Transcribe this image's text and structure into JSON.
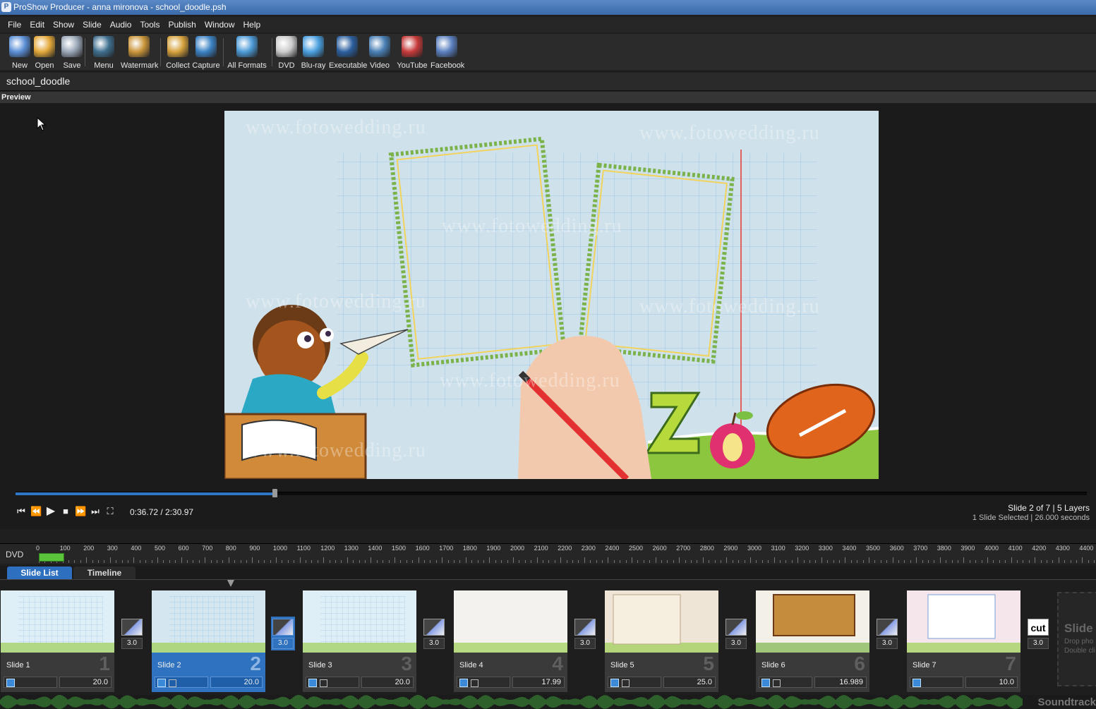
{
  "window": {
    "title": "ProShow Producer - anna mironova - school_doodle.psh"
  },
  "menu": [
    "File",
    "Edit",
    "Show",
    "Slide",
    "Audio",
    "Tools",
    "Publish",
    "Window",
    "Help"
  ],
  "toolbar": [
    {
      "label": "New",
      "icon": "new-show-icon",
      "color": "#5b8fd6"
    },
    {
      "label": "Open",
      "icon": "open-folder-icon",
      "color": "#e3a83a"
    },
    {
      "label": "Save",
      "icon": "save-disk-icon",
      "color": "#9aa7b8"
    },
    {
      "label": "Menu",
      "icon": "menu-screen-icon",
      "color": "#3e6e8e"
    },
    {
      "label": "Watermark",
      "icon": "watermark-stamp-icon",
      "color": "#c9953a"
    },
    {
      "label": "Collect",
      "icon": "collect-box-icon",
      "color": "#d6a23d"
    },
    {
      "label": "Capture",
      "icon": "camera-icon",
      "color": "#3b82c4"
    },
    {
      "label": "All Formats",
      "icon": "all-formats-icon",
      "color": "#4c9ad6"
    },
    {
      "label": "DVD",
      "icon": "dvd-disc-icon",
      "color": "#cccccc"
    },
    {
      "label": "Blu-ray",
      "icon": "bluray-disc-icon",
      "color": "#4aa0e0"
    },
    {
      "label": "Executable",
      "icon": "executable-screen-icon",
      "color": "#2c5f9e"
    },
    {
      "label": "Video",
      "icon": "video-film-icon",
      "color": "#4a7fb5"
    },
    {
      "label": "YouTube",
      "icon": "youtube-icon",
      "color": "#c63a3a"
    },
    {
      "label": "Facebook",
      "icon": "facebook-user-icon",
      "color": "#5a7fbf"
    }
  ],
  "show": {
    "name": "school_doodle"
  },
  "preview": {
    "label": "Preview",
    "watermark": "www.fotowedding.ru",
    "timecode": "0:36.72 / 2:30.97",
    "progress_fraction": 0.242,
    "slide_info": "Slide 2 of 7  |  5 Layers",
    "selection_info": "1 Slide Selected  |  26.000 seconds"
  },
  "ruler": {
    "label": "DVD",
    "ticks": [
      0,
      100,
      200,
      300,
      400,
      500,
      600,
      700,
      800,
      900,
      1000,
      1100,
      1200,
      1300,
      1400,
      1500,
      1600,
      1700,
      1800,
      1900,
      2000,
      2100,
      2200,
      2300,
      2400,
      2500,
      2600,
      2700,
      2800,
      2900,
      3000,
      3100,
      3200,
      3300,
      3400,
      3500,
      3600,
      3700,
      3800,
      3900,
      4000,
      4100,
      4200,
      4300,
      4400
    ],
    "capacity_fraction": 0.08
  },
  "tabs": [
    {
      "label": "Slide List",
      "active": true
    },
    {
      "label": "Timeline",
      "active": false
    }
  ],
  "slides": [
    {
      "name": "Slide 1",
      "number": "1",
      "duration": "20.0",
      "transition": "3.0",
      "transition_type": "fade",
      "selected": false,
      "layers_icon": false
    },
    {
      "name": "Slide 2",
      "number": "2",
      "duration": "20.0",
      "transition": "3.0",
      "transition_type": "fade",
      "selected": true,
      "layers_icon": true
    },
    {
      "name": "Slide 3",
      "number": "3",
      "duration": "20.0",
      "transition": "3.0",
      "transition_type": "fade",
      "selected": false,
      "layers_icon": true
    },
    {
      "name": "Slide 4",
      "number": "4",
      "duration": "17.99",
      "transition": "3.0",
      "transition_type": "fade",
      "selected": false,
      "layers_icon": true
    },
    {
      "name": "Slide 5",
      "number": "5",
      "duration": "25.0",
      "transition": "3.0",
      "transition_type": "fade",
      "selected": false,
      "layers_icon": true
    },
    {
      "name": "Slide 6",
      "number": "6",
      "duration": "16.989",
      "transition": "3.0",
      "transition_type": "fade",
      "selected": false,
      "layers_icon": true
    },
    {
      "name": "Slide 7",
      "number": "7",
      "duration": "10.0",
      "transition": "3.0",
      "transition_type": "cut",
      "selected": false,
      "layers_icon": false
    }
  ],
  "cut_label": "cut",
  "empty_slide": {
    "title": "Slide",
    "hint_1": "Drop pho",
    "hint_2": "Double cli"
  },
  "soundtrack": {
    "label": "Soundtrack"
  }
}
